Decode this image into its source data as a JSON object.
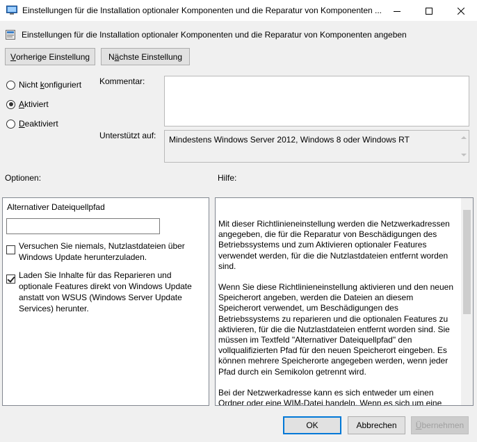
{
  "window": {
    "title": "Einstellungen für die Installation optionaler Komponenten und die Reparatur von Komponenten ...",
    "minimize_label": "Minimieren",
    "maximize_label": "Maximieren",
    "close_label": "Schließen"
  },
  "header": {
    "text": "Einstellungen für die Installation optionaler Komponenten und die Reparatur von Komponenten angeben"
  },
  "nav": {
    "prev": {
      "mnemonic": "V",
      "rest": "orherige Einstellung"
    },
    "next": {
      "pre": "N",
      "mnemonic": "ä",
      "rest": "chste Einstellung"
    }
  },
  "state": {
    "options": [
      {
        "pre": "Nicht ",
        "mnemonic": "k",
        "rest": "onfiguriert",
        "checked": false
      },
      {
        "pre": "",
        "mnemonic": "A",
        "rest": "ktiviert",
        "checked": true
      },
      {
        "pre": "",
        "mnemonic": "D",
        "rest": "eaktiviert",
        "checked": false
      }
    ]
  },
  "comment": {
    "label": "Kommentar:",
    "value": ""
  },
  "supported": {
    "label": "Unterstützt auf:",
    "value": "Mindestens Windows Server 2012, Windows 8 oder Windows RT"
  },
  "options_panel": {
    "section_label": "Optionen:",
    "path_label": "Alternativer Dateiquellpfad",
    "path_value": "",
    "checkbox1": {
      "text": "Versuchen Sie niemals, Nutzlastdateien über Windows Update herunterzuladen.",
      "checked": false
    },
    "checkbox2": {
      "text": "Laden Sie Inhalte für das Reparieren und optionale Features direkt von Windows Update anstatt von WSUS (Windows Server Update Services) herunter.",
      "checked": true
    }
  },
  "help_panel": {
    "section_label": "Hilfe:",
    "paragraphs": [
      "Mit dieser Richtlinieneinstellung werden die Netzwerkadressen angegeben, die für die Reparatur von Beschädigungen des Betriebssystems und zum Aktivieren optionaler Features verwendet werden, für die die Nutzlastdateien entfernt worden sind.",
      "Wenn Sie diese Richtlinieneinstellung aktivieren und den neuen Speicherort angeben, werden die Dateien an diesem Speicherort verwendet, um Beschädigungen des Betriebssystems zu reparieren und die optionalen Features zu aktivieren, für die die Nutzlastdateien entfernt worden sind. Sie müssen im Textfeld \"Alternativer Dateiquellpfad\" den vollqualifizierten Pfad für den neuen Speicherort eingeben. Es können mehrere Speicherorte angegeben werden, wenn jeder Pfad durch ein Semikolon getrennt wird.",
      "Bei der Netzwerkadresse kann es sich entweder um einen Ordner oder eine WIM-Datei handeln. Wenn es sich um eine WIM-Datei"
    ]
  },
  "footer": {
    "ok": "OK",
    "cancel": "Abbrechen",
    "apply": {
      "mnemonic": "Ü",
      "rest": "bernehmen"
    }
  }
}
